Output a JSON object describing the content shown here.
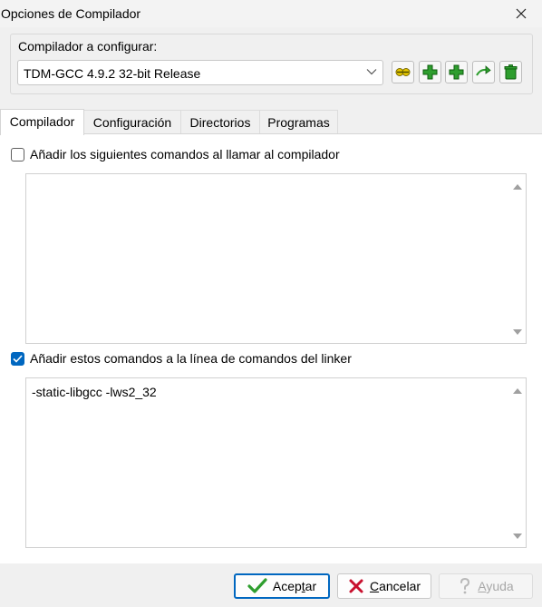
{
  "window": {
    "title": "Opciones de Compilador"
  },
  "compiler_group": {
    "label": "Compilador a configurar:",
    "selected": "TDM-GCC 4.9.2 32-bit Release",
    "toolbar": [
      {
        "icon": "rename-icon"
      },
      {
        "icon": "add-icon"
      },
      {
        "icon": "add-copy-icon"
      },
      {
        "icon": "find-compilers-icon"
      },
      {
        "icon": "delete-icon"
      }
    ]
  },
  "tabs": [
    {
      "label": "Compilador",
      "active": true
    },
    {
      "label": "Configuración",
      "active": false
    },
    {
      "label": "Directorios",
      "active": false
    },
    {
      "label": "Programas",
      "active": false
    }
  ],
  "compiler_tab": {
    "compiler_cmds": {
      "label": "Añadir los siguientes comandos al llamar al compilador",
      "checked": false,
      "value": ""
    },
    "linker_cmds": {
      "label": "Añadir estos comandos a la línea de comandos del linker",
      "checked": true,
      "value": "-static-libgcc -lws2_32"
    }
  },
  "buttons": {
    "ok": {
      "pre": "Acep",
      "underline": "t",
      "post": "ar"
    },
    "cancel": {
      "pre": "",
      "underline": "C",
      "post": "ancelar"
    },
    "help": {
      "pre": "",
      "underline": "A",
      "post": "yuda"
    }
  },
  "colors": {
    "accent": "#0067c0",
    "icon_green": "#2e9e2e",
    "icon_yellow": "#e8c800",
    "cancel_red": "#c8102e"
  }
}
